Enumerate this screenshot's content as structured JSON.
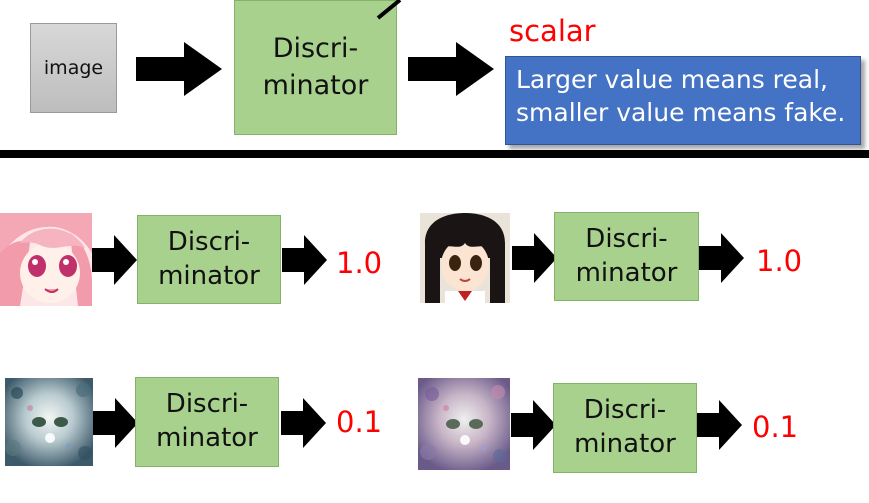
{
  "top": {
    "input_label": "image",
    "disc_line1": "Discri-",
    "disc_line2": "minator",
    "output_label": "scalar",
    "note_line1": "Larger value means real,",
    "note_line2": "smaller value means fake."
  },
  "examples": [
    {
      "disc_line1": "Discri-",
      "disc_line2": "minator",
      "score": "1.0"
    },
    {
      "disc_line1": "Discri-",
      "disc_line2": "minator",
      "score": "1.0"
    },
    {
      "disc_line1": "Discri-",
      "disc_line2": "minator",
      "score": "0.1"
    },
    {
      "disc_line1": "Discri-",
      "disc_line2": "minator",
      "score": "0.1"
    }
  ],
  "colors": {
    "box_green": "#a9d18e",
    "note_blue": "#4472c4",
    "score_red": "#ff0000",
    "arrow": "#000000"
  },
  "icons": [
    "arrow-right-icon",
    "anime-face-image",
    "noisy-face-image"
  ]
}
